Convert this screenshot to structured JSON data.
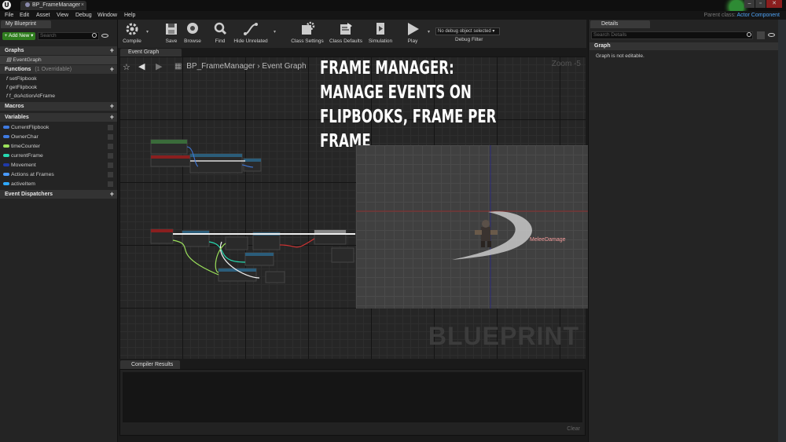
{
  "window": {
    "app_logo": "U",
    "doc_tab": "BP_FrameManager",
    "parent_class_label": "Parent class:",
    "parent_class_value": "Actor Component",
    "controls": {
      "minimize": "‒",
      "maximize": "▫",
      "close": "✕"
    }
  },
  "menu": [
    "File",
    "Edit",
    "Asset",
    "View",
    "Debug",
    "Window",
    "Help"
  ],
  "my_blueprint": {
    "tab": "My Blueprint",
    "add_new": "+ Add New ▾",
    "search_placeholder": "Search",
    "graphs_header": "Graphs",
    "graphs": [
      "EventGraph"
    ],
    "functions_header": "Functions",
    "functions_sub": "(1 Overridable)",
    "functions": [
      "setFlipbook",
      "getFlipbook",
      "f_doActionAtFrame"
    ],
    "macros_header": "Macros",
    "variables_header": "Variables",
    "variables": [
      {
        "name": "CurrentFlipbook",
        "color": "#3f7ae0"
      },
      {
        "name": "OwnerChar",
        "color": "#3f7ae0"
      },
      {
        "name": "timeCounter",
        "color": "#9be05b"
      },
      {
        "name": "currentFrame",
        "color": "#26d9b0"
      },
      {
        "name": "Movement",
        "color": "#1f3aa8"
      },
      {
        "name": "Actions at Frames",
        "color": "#4a9bff"
      },
      {
        "name": "activeItem",
        "color": "#2fa9ff"
      }
    ],
    "dispatchers_header": "Event Dispatchers"
  },
  "toolbar": {
    "compile": "Compile",
    "save": "Save",
    "browse": "Browse",
    "find": "Find",
    "hide_unrelated": "Hide Unrelated",
    "class_settings": "Class Settings",
    "class_defaults": "Class Defaults",
    "simulation": "Simulation",
    "play": "Play",
    "debug_object": "No debug object selected ▾",
    "debug_filter": "Debug Filter"
  },
  "graph": {
    "tab": "Event Graph",
    "breadcrumb_blueprint": "BP_FrameManager",
    "breadcrumb_sep": "›",
    "breadcrumb_graph": "Event Graph",
    "zoom": "Zoom -5",
    "watermark": "BLUEPRINT"
  },
  "overlay_title": "Frame Manager: Manage events on flipbooks, frame per frame",
  "preview": {
    "label": "MeleeDamage"
  },
  "compiler": {
    "tab": "Compiler Results",
    "clear": "Clear"
  },
  "details": {
    "tab": "Details",
    "search_placeholder": "Search Details",
    "graph_header": "Graph",
    "message": "Graph is not editable."
  }
}
